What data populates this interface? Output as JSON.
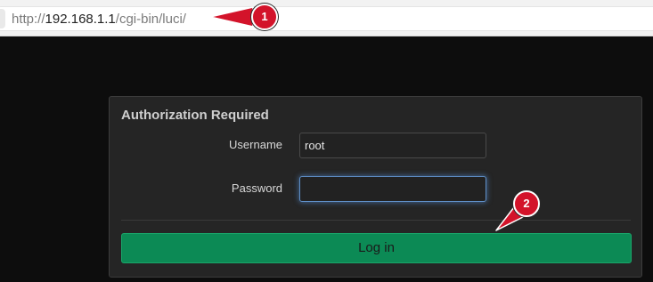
{
  "browser": {
    "url_prefix": "http://",
    "url_host": "192.168.1.1",
    "url_path": "/cgi-bin/luci/"
  },
  "login": {
    "title": "Authorization Required",
    "username_label": "Username",
    "username_value": "root",
    "password_label": "Password",
    "password_value": "",
    "login_button": "Log in"
  },
  "annotations": {
    "callout_1": "1",
    "callout_2": "2",
    "callout_color": "#d3132a"
  },
  "colors": {
    "page_background": "#0d0d0d",
    "panel_background": "#252525",
    "login_button": "#0c8a55",
    "focus_ring": "#5f8fc7"
  }
}
